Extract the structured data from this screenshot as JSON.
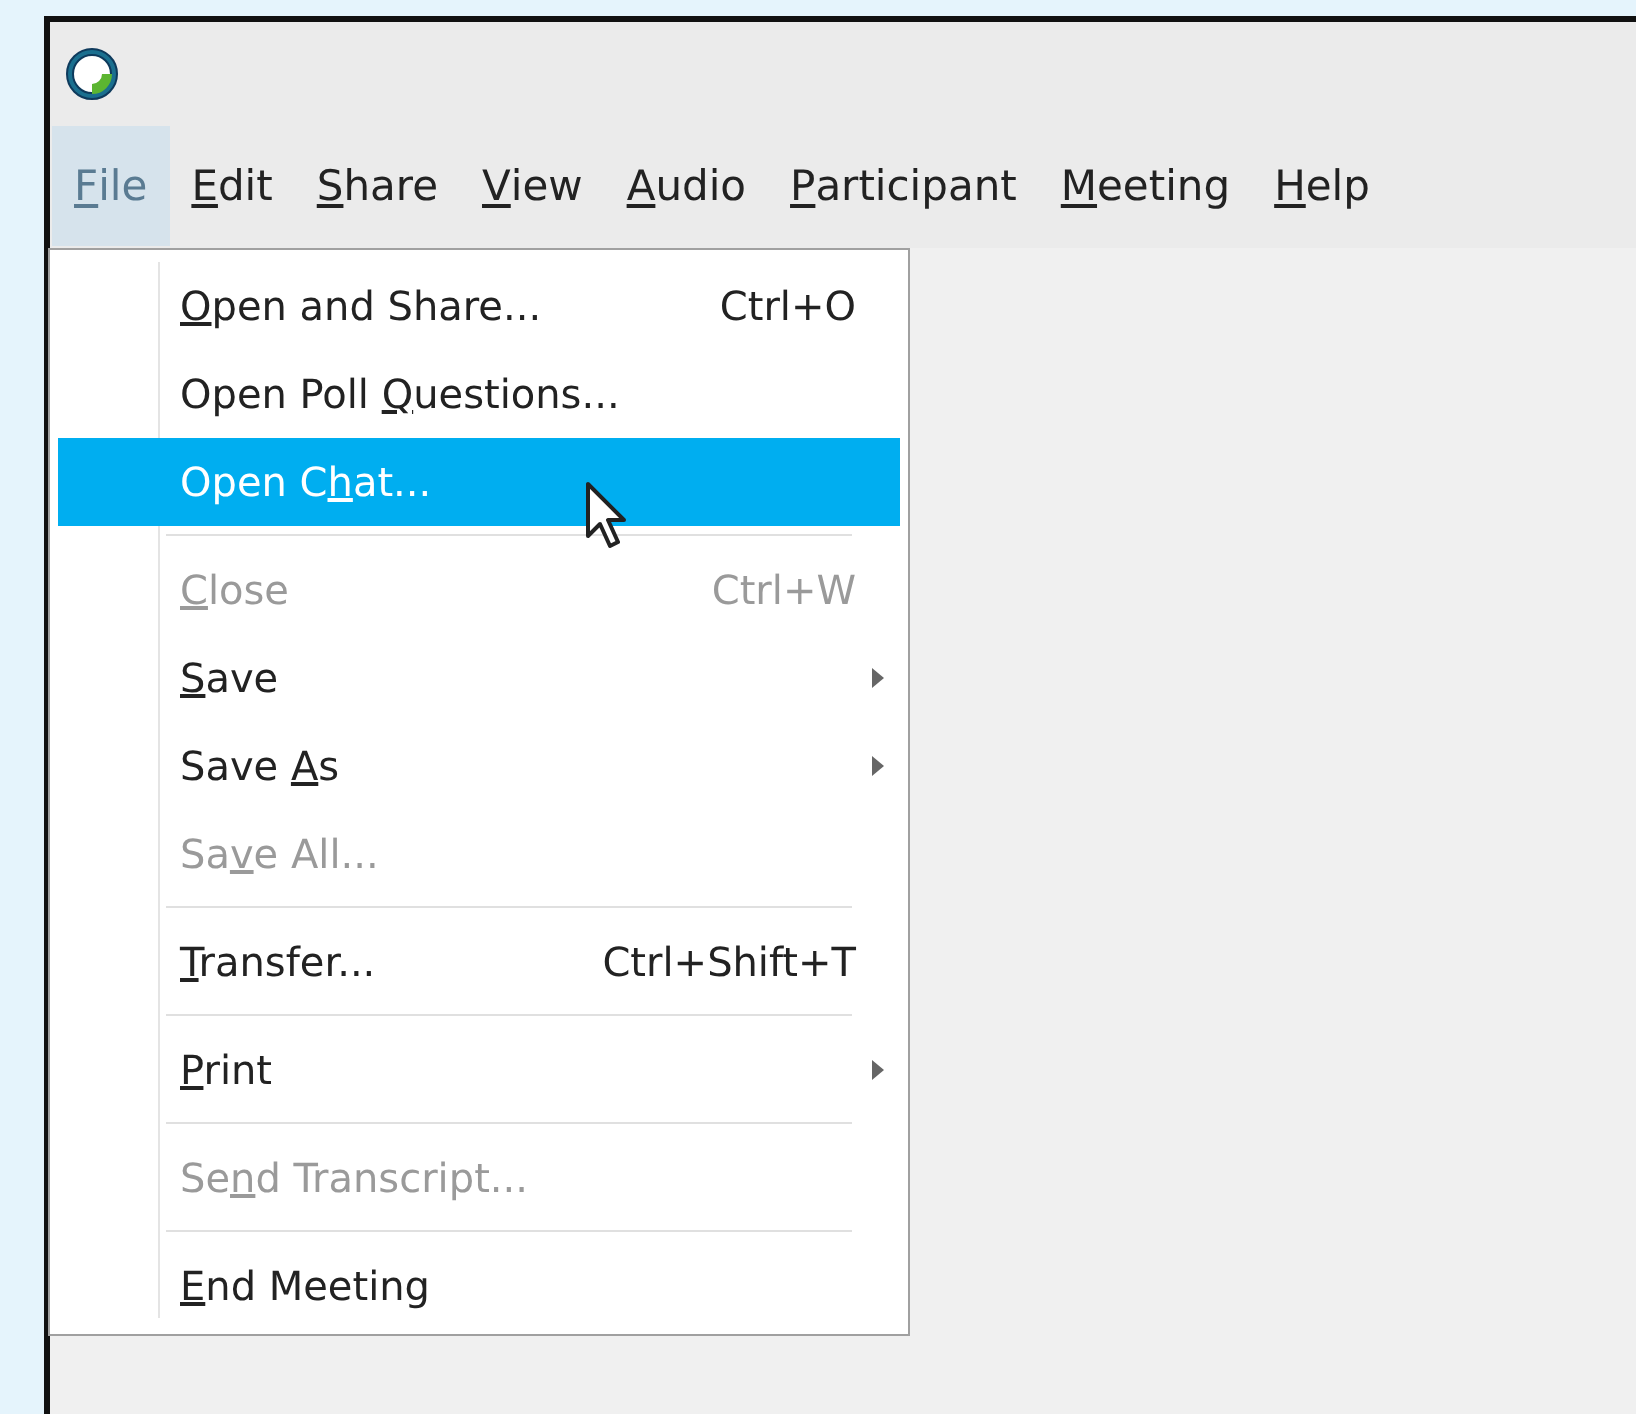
{
  "menubar": [
    {
      "key": "F",
      "post": "ile",
      "selected": true
    },
    {
      "key": "E",
      "post": "dit",
      "selected": false
    },
    {
      "key": "S",
      "post": "hare",
      "selected": false
    },
    {
      "key": "V",
      "post": "iew",
      "selected": false
    },
    {
      "key": "A",
      "post": "udio",
      "selected": false
    },
    {
      "key": "P",
      "post": "articipant",
      "selected": false
    },
    {
      "key": "M",
      "post": "eeting",
      "selected": false
    },
    {
      "key": "H",
      "post": "elp",
      "selected": false
    }
  ],
  "file_menu": [
    {
      "kind": "item",
      "key": "O",
      "post": "pen and Share...",
      "shortcut": "Ctrl+O",
      "disabled": false,
      "selected": false
    },
    {
      "kind": "item",
      "pre": "Open Poll ",
      "key": "Q",
      "post": "uestions...",
      "disabled": false,
      "selected": false
    },
    {
      "kind": "item",
      "pre": "Open C",
      "key": "h",
      "post": "at...",
      "disabled": false,
      "selected": true
    },
    {
      "kind": "separator"
    },
    {
      "kind": "item",
      "key": "C",
      "post": "lose",
      "shortcut": "Ctrl+W",
      "disabled": true,
      "selected": false
    },
    {
      "kind": "submenu",
      "key": "S",
      "post": "ave",
      "disabled": false,
      "selected": false
    },
    {
      "kind": "submenu",
      "pre": "Save ",
      "key": "A",
      "post": "s",
      "disabled": false,
      "selected": false
    },
    {
      "kind": "item",
      "pre": "Sa",
      "key": "v",
      "post": "e All...",
      "disabled": true,
      "selected": false
    },
    {
      "kind": "separator"
    },
    {
      "kind": "item",
      "key": "T",
      "post": "ransfer...",
      "shortcut": "Ctrl+Shift+T",
      "disabled": false,
      "selected": false
    },
    {
      "kind": "separator"
    },
    {
      "kind": "submenu",
      "key": "P",
      "post": "rint",
      "disabled": false,
      "selected": false
    },
    {
      "kind": "separator"
    },
    {
      "kind": "item",
      "pre": "Se",
      "key": "n",
      "post": "d Transcript...",
      "disabled": true,
      "selected": false
    },
    {
      "kind": "separator"
    },
    {
      "kind": "item",
      "key": "E",
      "post": "nd Meeting",
      "disabled": false,
      "selected": false
    }
  ]
}
